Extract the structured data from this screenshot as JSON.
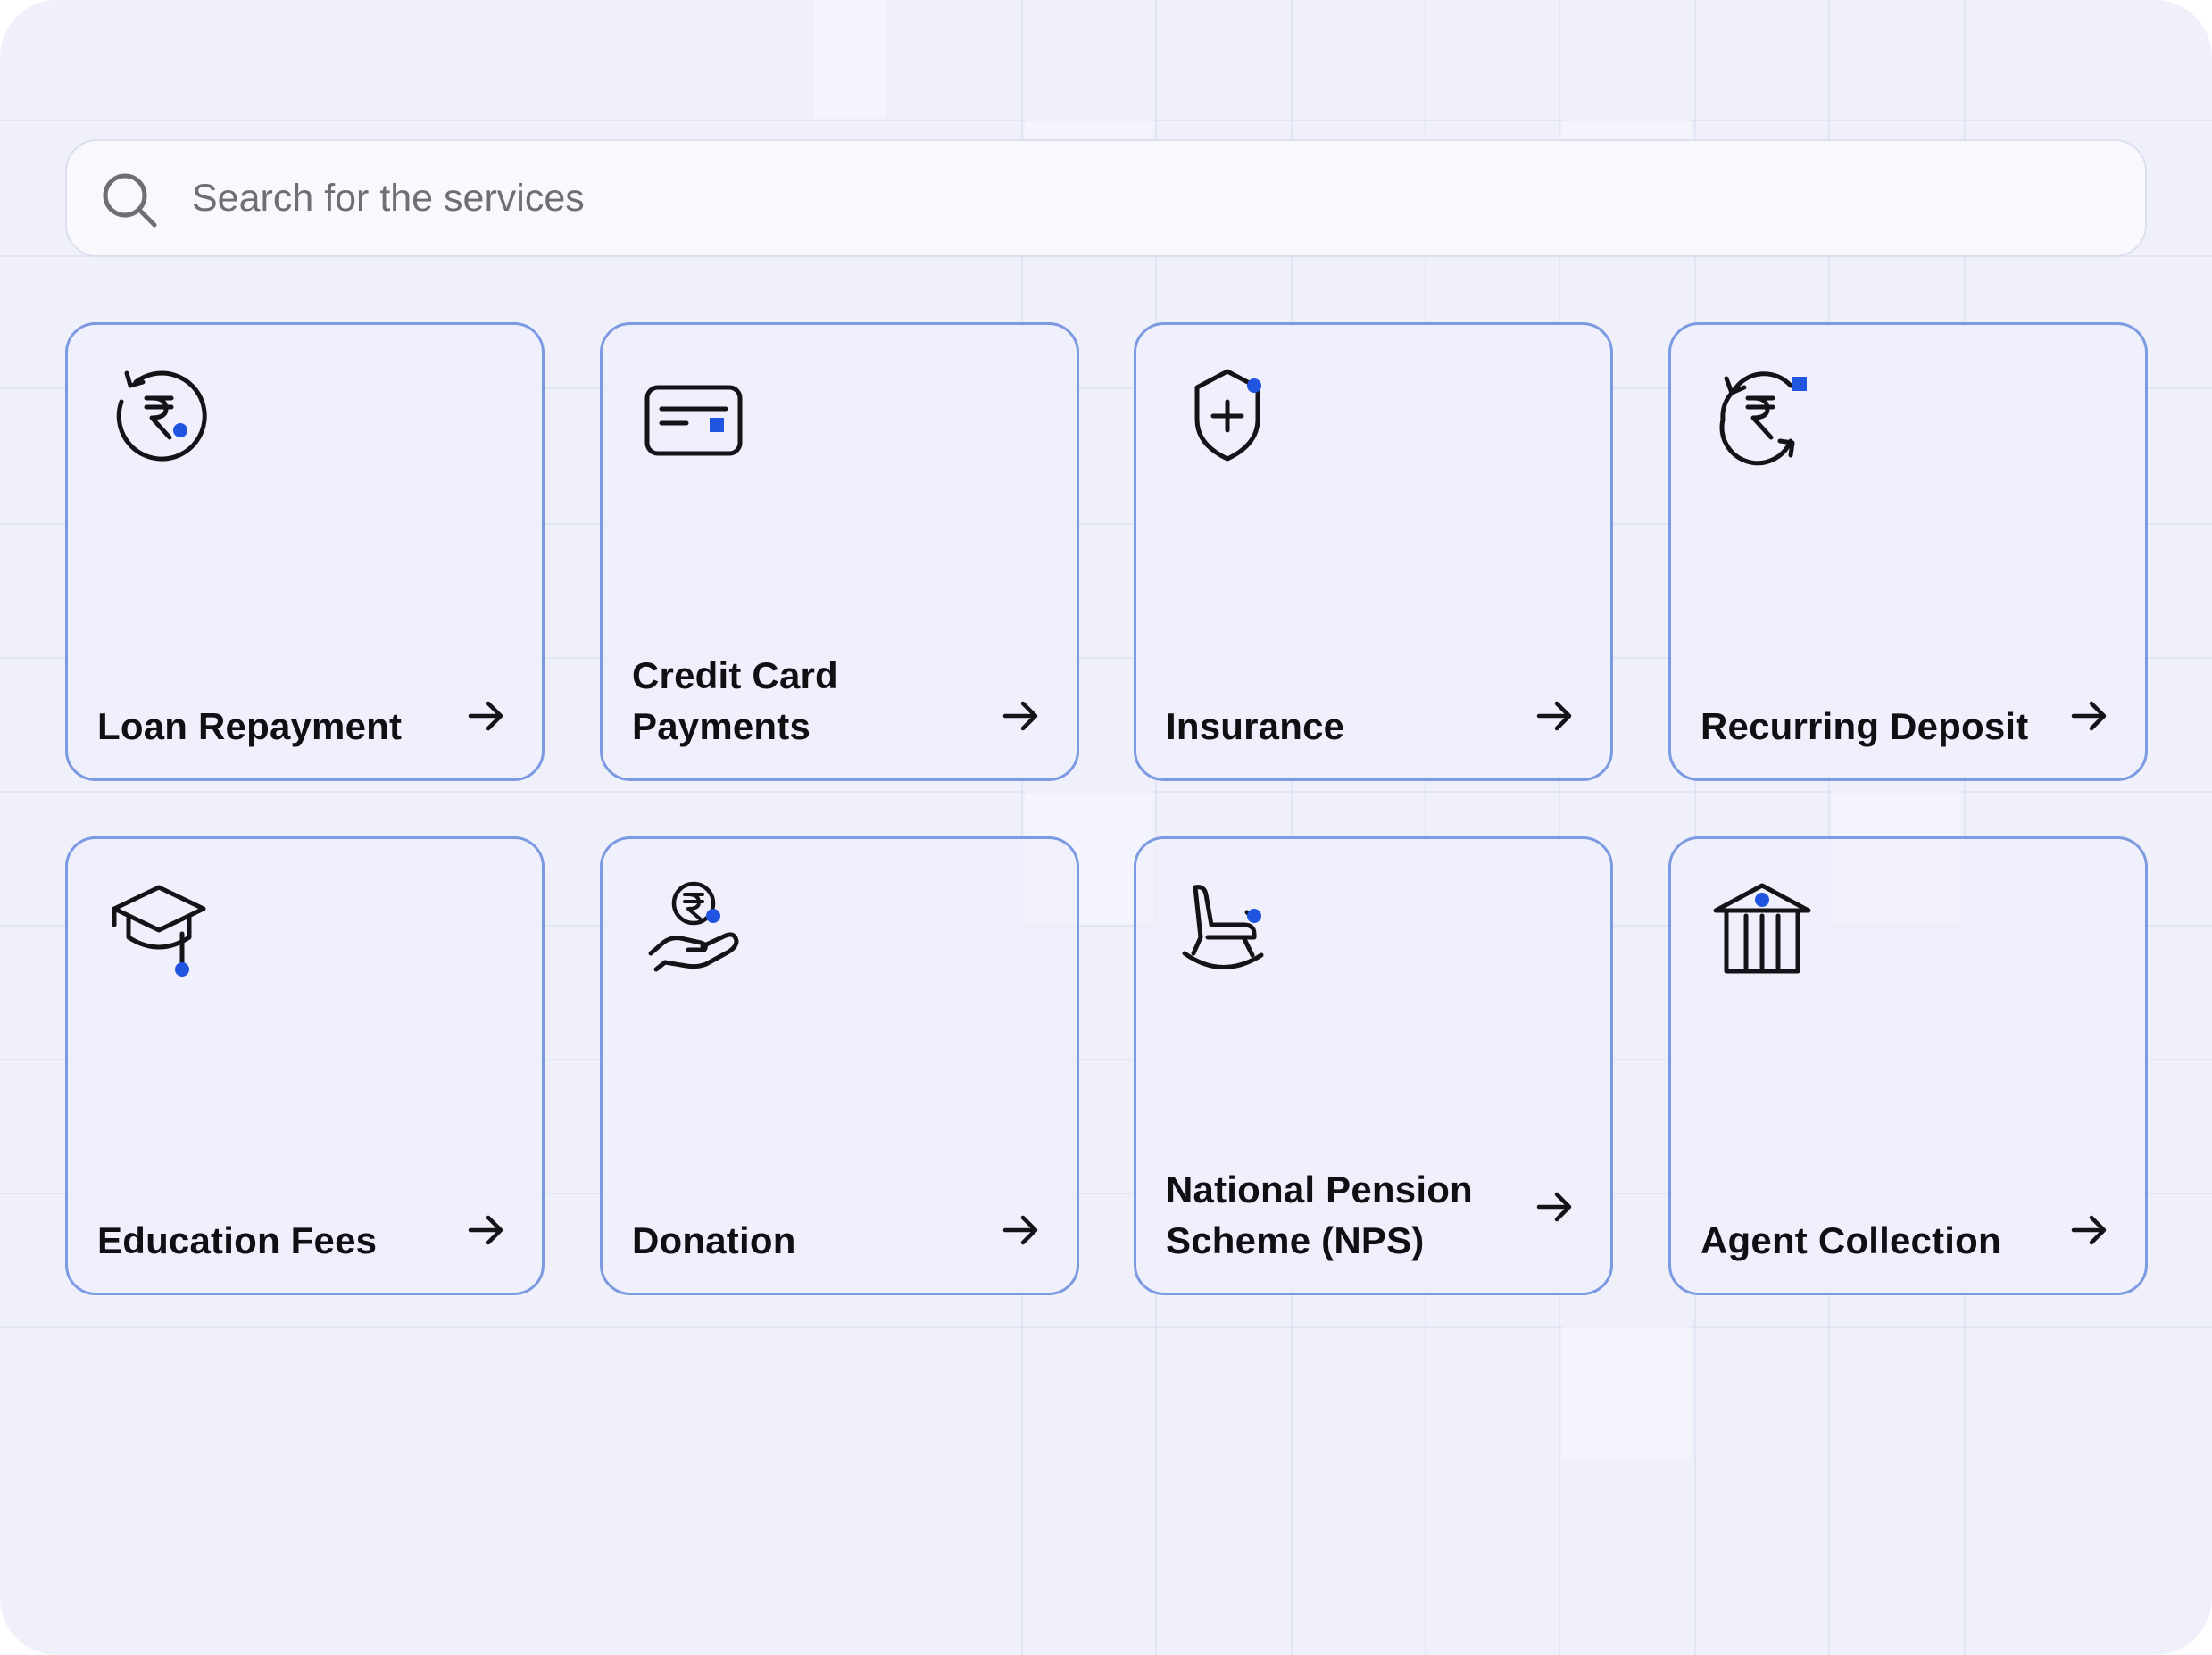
{
  "search": {
    "placeholder": "Search for the services",
    "icon": "search-icon"
  },
  "colors": {
    "background": "#eff0fa",
    "card_border": "#7c9ae1",
    "accent_dot": "#1f55e0",
    "icon_stroke": "#141418"
  },
  "services": [
    {
      "label": "Loan Repayment",
      "icon": "rupee-refresh-icon"
    },
    {
      "label": "Credit Card Payments",
      "icon": "credit-card-icon"
    },
    {
      "label": "Insurance",
      "icon": "shield-plus-icon"
    },
    {
      "label": "Recurring Deposit",
      "icon": "rupee-cycle-icon"
    },
    {
      "label": "Education Fees",
      "icon": "graduation-cap-icon"
    },
    {
      "label": "Donation",
      "icon": "hand-rupee-icon"
    },
    {
      "label": "National Pension Scheme (NPS)",
      "icon": "rocking-chair-icon"
    },
    {
      "label": "Agent Collection",
      "icon": "bank-icon"
    }
  ]
}
